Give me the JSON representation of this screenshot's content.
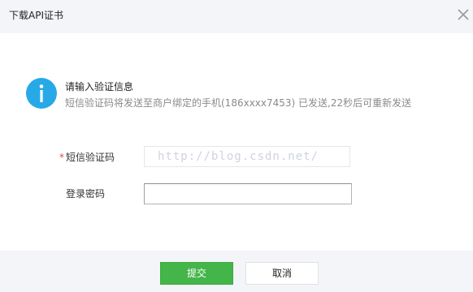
{
  "dialog": {
    "title": "下载API证书",
    "close_icon": "close-icon"
  },
  "info": {
    "icon": "info-icon",
    "icon_color": "#27a9e8",
    "title": "请输入验证信息",
    "description": "短信验证码将发送至商户绑定的手机(186xxxx7453) 已发送,22秒后可重新发送"
  },
  "form": {
    "sms_required_mark": "*",
    "sms_label": "短信验证码",
    "sms_value": "http://blog.csdn.net/",
    "password_label": "登录密码",
    "password_value": ""
  },
  "footer": {
    "submit_label": "提交",
    "cancel_label": "取消",
    "submit_color": "#44b549"
  }
}
